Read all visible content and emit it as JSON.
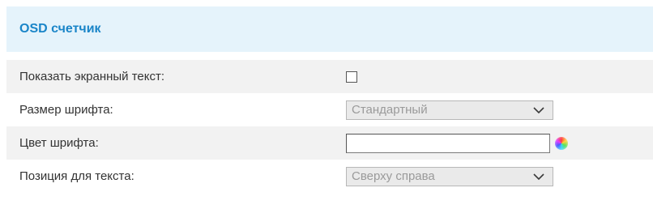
{
  "section": {
    "title": "OSD счетчик"
  },
  "rows": [
    {
      "label": "Показать экранный текст:",
      "checked": false
    },
    {
      "label": "Размер шрифта:",
      "value": "Стандартный"
    },
    {
      "label": "Цвет шрифта:",
      "value": ""
    },
    {
      "label": "Позиция для текста:",
      "value": "Сверху справа"
    }
  ],
  "icons": {
    "select_arrow": "chevron-down-icon",
    "color_picker": "color-wheel-icon"
  }
}
